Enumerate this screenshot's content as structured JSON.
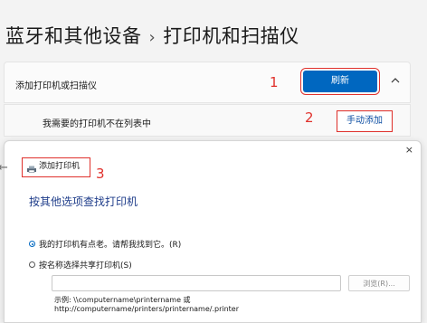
{
  "breadcrumb": {
    "parent": "蓝牙和其他设备",
    "separator": "›",
    "current": "打印机和扫描仪"
  },
  "printers_section": {
    "add_label": "添加打印机或扫描仪",
    "refresh_label": "刷新",
    "not_listed_label": "我需要的打印机不在列表中",
    "manual_add_label": "手动添加"
  },
  "annotations": [
    "1",
    "2",
    "3"
  ],
  "dialog": {
    "title": "添加打印机",
    "heading": "按其他选项查找打印机",
    "option_older": "我的打印机有点老。请帮我找到它。(R)",
    "option_shared": "按名称选择共享打印机(S)",
    "browse_label": "浏览(R)...",
    "example_line1": "示例: \\\\computername\\printername 或",
    "example_line2": "http://computername/printers/printername/.printer",
    "close_glyph": "×",
    "back_glyph": "←"
  },
  "colors": {
    "accent": "#0067c0",
    "annotation": "#e0312c",
    "heading": "#1f3d8a"
  },
  "icons": [
    "chevron-up-icon",
    "close-icon",
    "back-arrow-icon",
    "printer-icon"
  ]
}
